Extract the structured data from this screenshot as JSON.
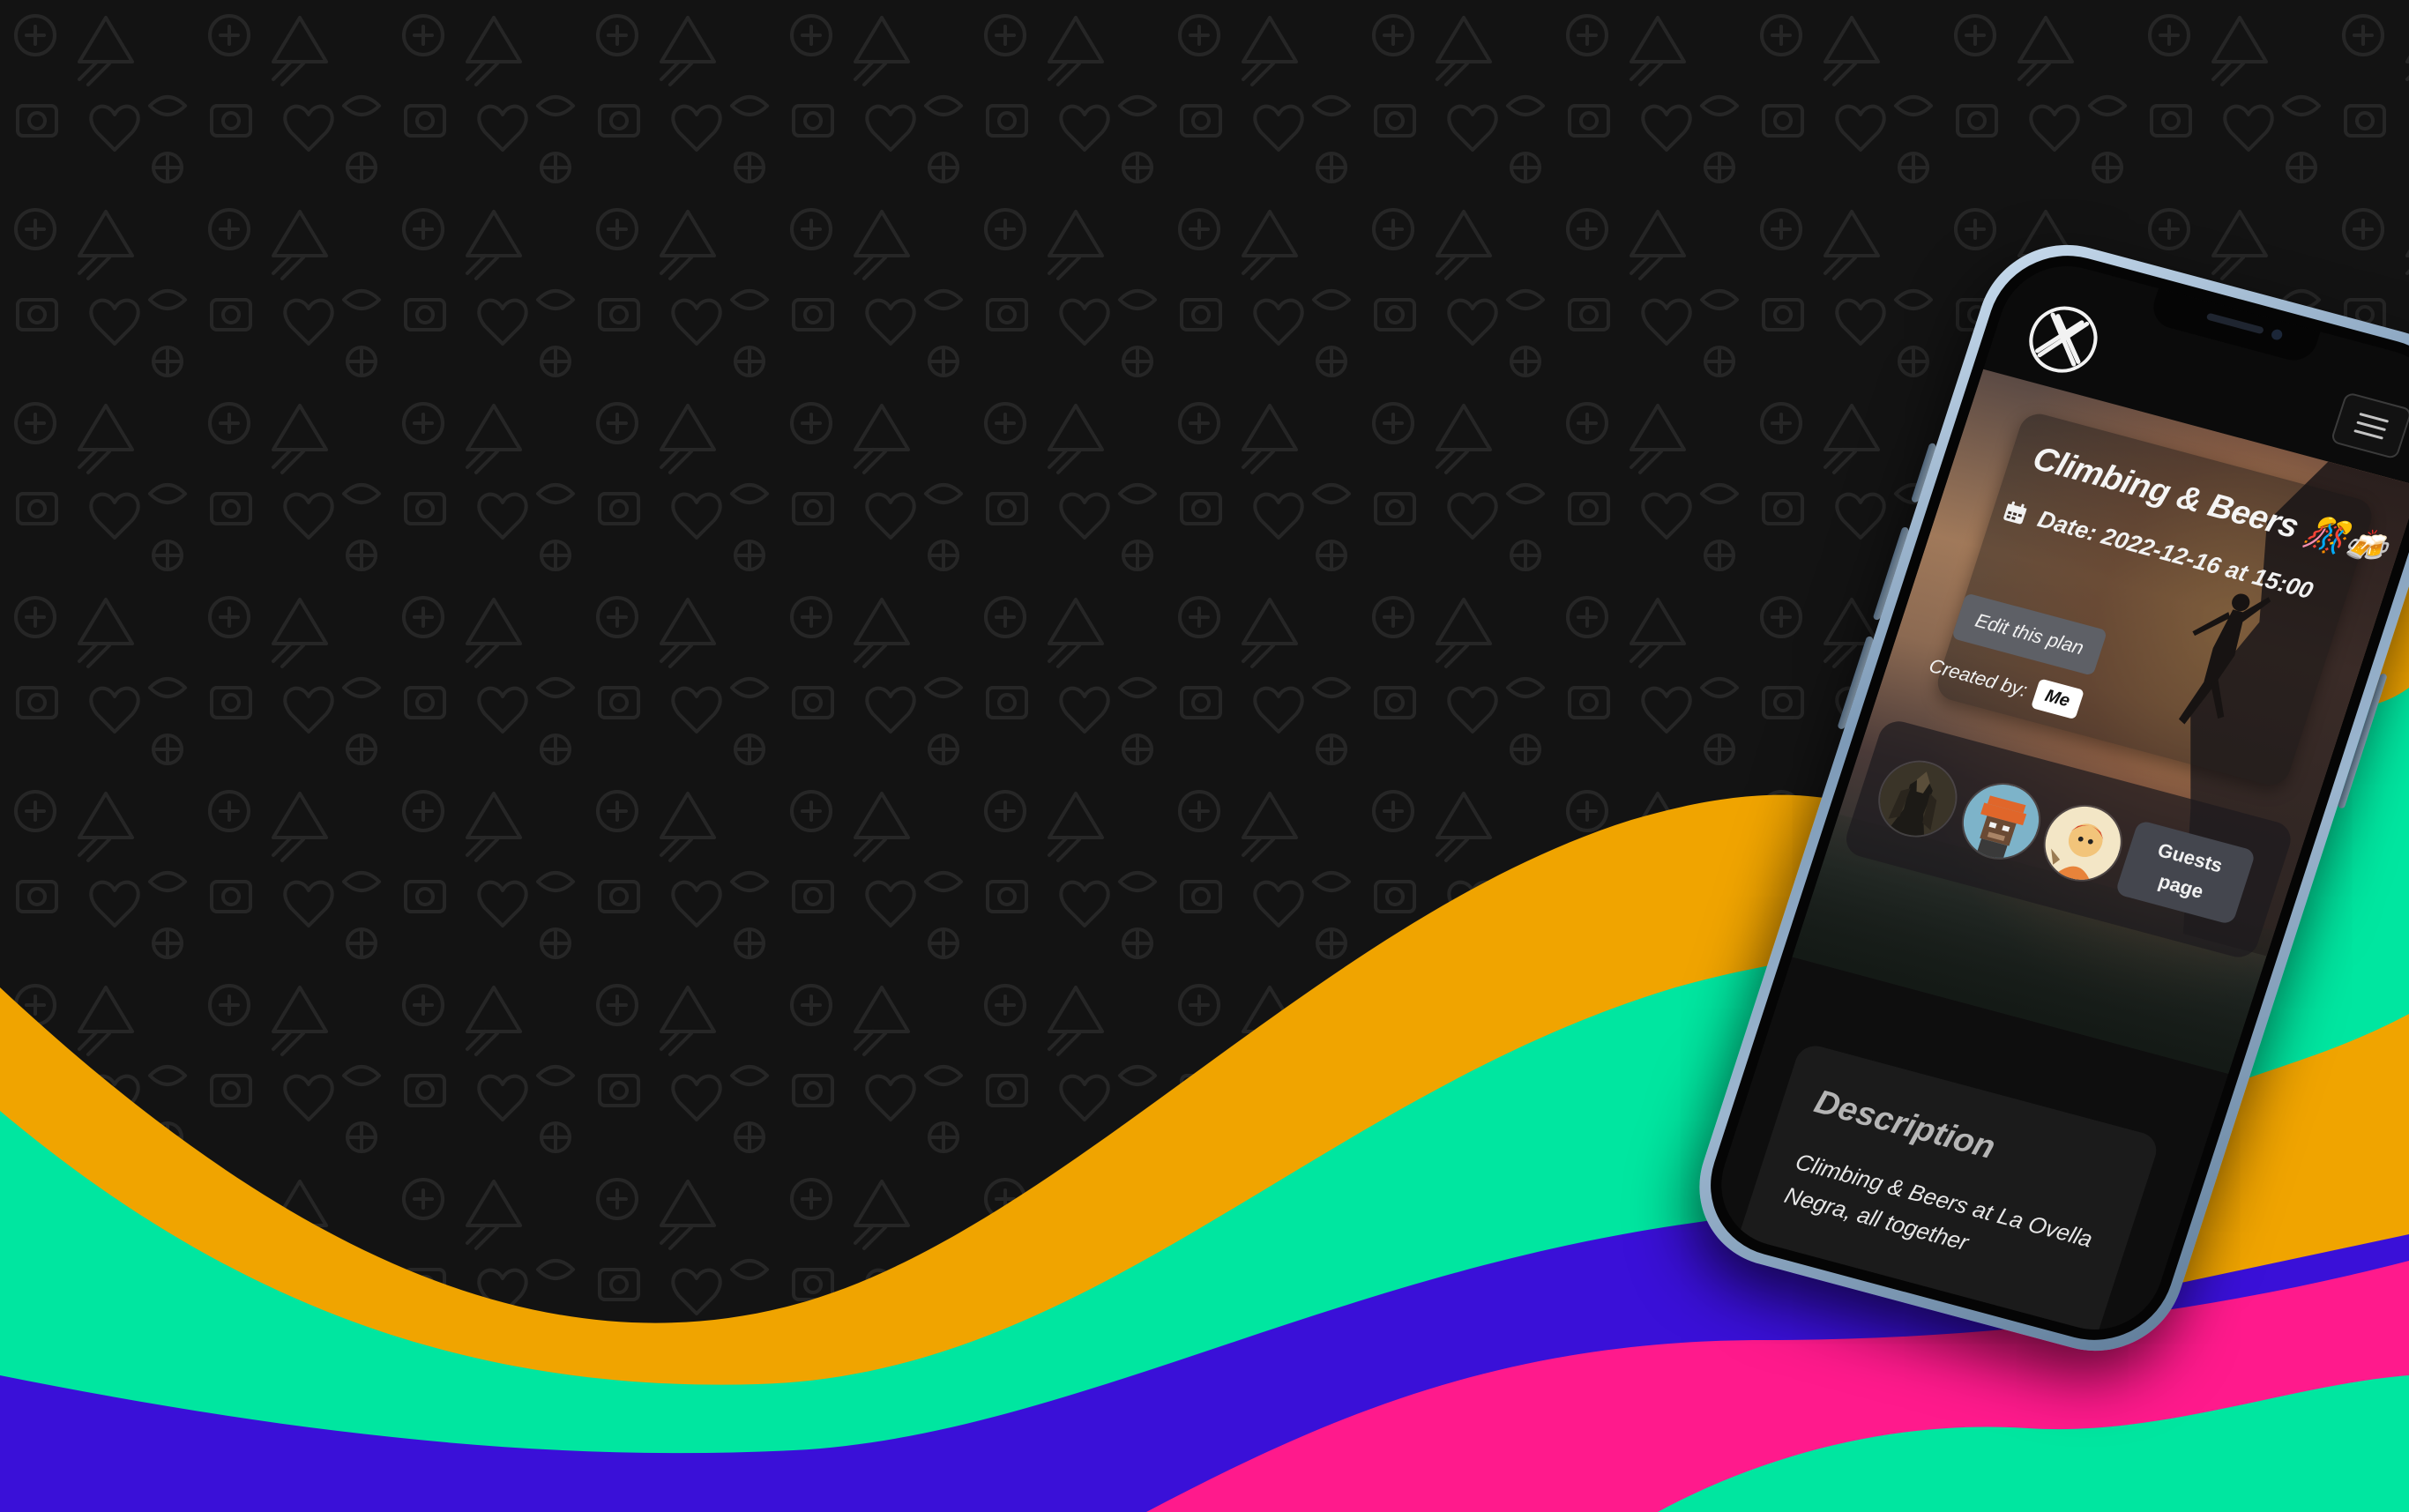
{
  "app": {
    "logo_icon": "x-circle-logo-icon",
    "menu_icon": "hamburger-menu-icon"
  },
  "plan": {
    "title": "Climbing & Beers 🎊🍻",
    "date_label": "Date: 2022-12-16 at 15:00",
    "date_icon": "calendar-icon",
    "edit_label": "Edit this plan",
    "created_by_label": "Created by:",
    "created_by_value": "Me"
  },
  "guests": {
    "avatars": [
      "guest-avatar-armored-figure",
      "guest-avatar-pixel-ape",
      "guest-avatar-cartoon-character"
    ],
    "button_label": "Guests page"
  },
  "description": {
    "title": "Description",
    "text": "Climbing & Beers at La Ovella Negra, all together"
  },
  "colors": {
    "background": "#141414",
    "wave_orange": "#f0a400",
    "wave_green": "#00e6a0",
    "wave_blue": "#3a10d8",
    "wave_pink": "#ff1a8c",
    "phone_frame": "#9cb6cf"
  }
}
